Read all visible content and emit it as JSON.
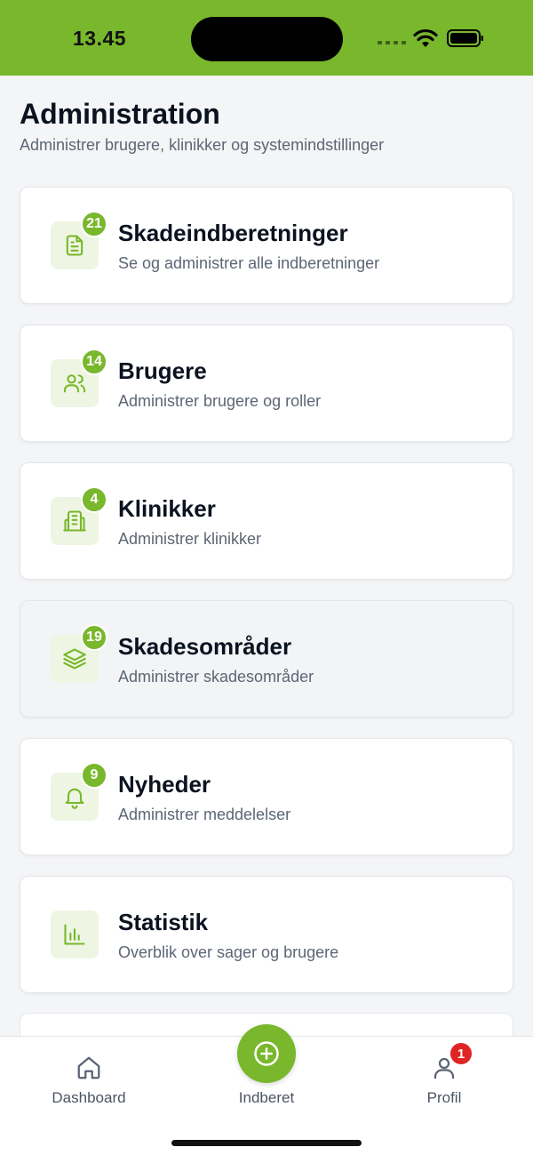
{
  "status_bar": {
    "time": "13.45",
    "color": "#79b72c"
  },
  "header": {
    "title": "Administration",
    "subtitle": "Administrer brugere, klinikker og systemindstillinger"
  },
  "cards": [
    {
      "title": "Skadeindberetninger",
      "desc": "Se og administrer alle indberetninger",
      "badge": "21",
      "icon": "document-icon"
    },
    {
      "title": "Brugere",
      "desc": "Administrer brugere og roller",
      "badge": "14",
      "icon": "users-icon"
    },
    {
      "title": "Klinikker",
      "desc": "Administrer klinikker",
      "badge": "4",
      "icon": "building-icon"
    },
    {
      "title": "Skadesområder",
      "desc": "Administrer skadesområder",
      "badge": "19",
      "icon": "layers-icon"
    },
    {
      "title": "Nyheder",
      "desc": "Administrer meddelelser",
      "badge": "9",
      "icon": "bell-icon"
    },
    {
      "title": "Statistik",
      "desc": "Overblik over sager og brugere",
      "badge": "",
      "icon": "bar-chart-icon"
    }
  ],
  "tab_bar": {
    "dashboard_label": "Dashboard",
    "report_label": "Indberet",
    "profile_label": "Profil",
    "profile_badge": "1"
  },
  "colors": {
    "accent": "#79b72c",
    "badge_alert": "#e02424",
    "icon_bg": "#eef6e3"
  }
}
